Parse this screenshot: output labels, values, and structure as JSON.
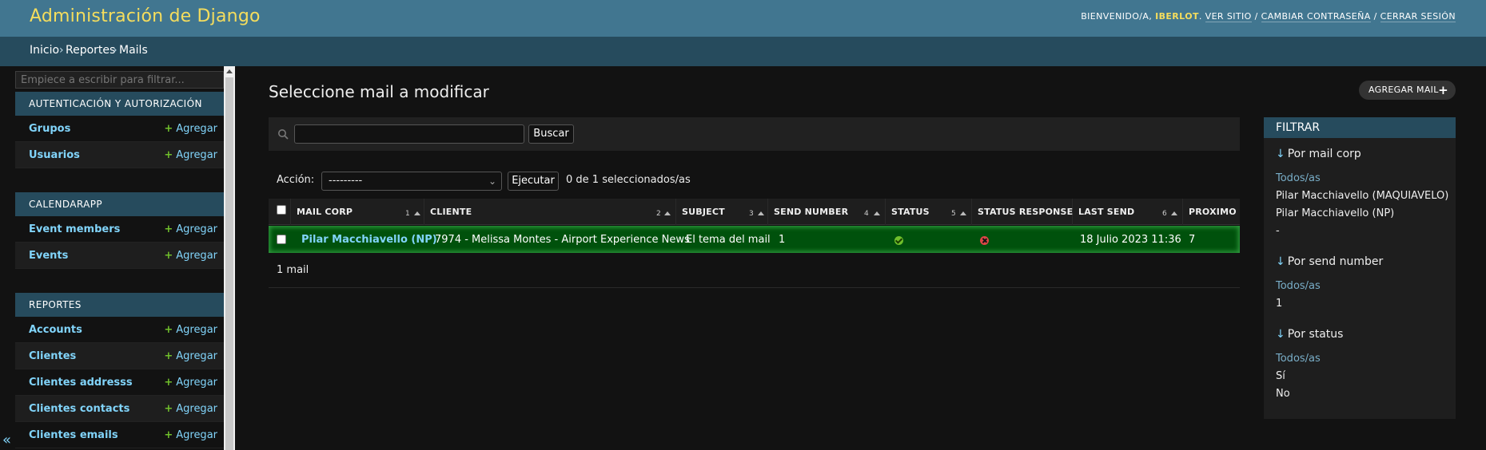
{
  "header": {
    "brand": "Administración de Django",
    "welcome": "BIENVENIDO/A,",
    "username": "IBERLOT",
    "view_site": "VER SITIO",
    "change_password": "CAMBIAR CONTRASEÑA",
    "logout": "CERRAR SESIÓN",
    "separator": "/"
  },
  "breadcrumbs": {
    "home": "Inicio",
    "app": "Reportes",
    "model": "Mails",
    "sep": "›"
  },
  "sidebar": {
    "filter_placeholder": "Empiece a escribir para filtrar...",
    "add_label": "Agregar",
    "collapse_icon": "«",
    "apps": [
      {
        "name": "AUTENTICACIÓN Y AUTORIZACIÓN",
        "models": [
          "Grupos",
          "Usuarios"
        ]
      },
      {
        "name": "CALENDARAPP",
        "models": [
          "Event members",
          "Events"
        ]
      },
      {
        "name": "REPORTES",
        "models": [
          "Accounts",
          "Clientes",
          "Clientes addresss",
          "Clientes contacts",
          "Clientes emails"
        ]
      }
    ]
  },
  "main": {
    "title": "Seleccione mail a modificar",
    "add_button": "AGREGAR MAIL",
    "search_button": "Buscar",
    "action_label": "Acción:",
    "action_selected": "---------",
    "run_button": "Ejecutar",
    "selection_counter": "0 de 1 seleccionados/as",
    "columns": [
      {
        "label": "MAIL CORP",
        "sort": "1"
      },
      {
        "label": "CLIENTE",
        "sort": "2"
      },
      {
        "label": "SUBJECT",
        "sort": "3"
      },
      {
        "label": "SEND NUMBER",
        "sort": "4"
      },
      {
        "label": "STATUS",
        "sort": "5"
      },
      {
        "label": "STATUS RESPONSE",
        "sort": ""
      },
      {
        "label": "LAST SEND",
        "sort": "6"
      },
      {
        "label": "PROXIMO",
        "sort": ""
      }
    ],
    "rows": [
      {
        "mail_corp": "Pilar Macchiavello (NP)",
        "cliente": "7974 - Melissa Montes - Airport Experience News",
        "subject": "El tema del mail",
        "send_number": "1",
        "status": "ok-icon",
        "status_response": "error-icon",
        "last_send": "18 Julio 2023 11:36",
        "proximo": "7"
      }
    ],
    "paginator": "1 mail"
  },
  "filter": {
    "title": "FILTRAR",
    "groups": [
      {
        "title": "Por mail corp",
        "options": [
          "Todos/as",
          "Pilar Macchiavello (MAQUIAVELO)",
          "Pilar Macchiavello (NP)",
          "-"
        ]
      },
      {
        "title": "Por send number",
        "options": [
          "Todos/as",
          "1"
        ]
      },
      {
        "title": "Por status",
        "options": [
          "Todos/as",
          "Sí",
          "No"
        ]
      }
    ]
  },
  "colors": {
    "header_bg": "#417690",
    "brand": "#f5dd5d",
    "breadcrumbs_bg": "#264b5d",
    "link": "#81d4fa",
    "selected_row": "#00510c"
  }
}
